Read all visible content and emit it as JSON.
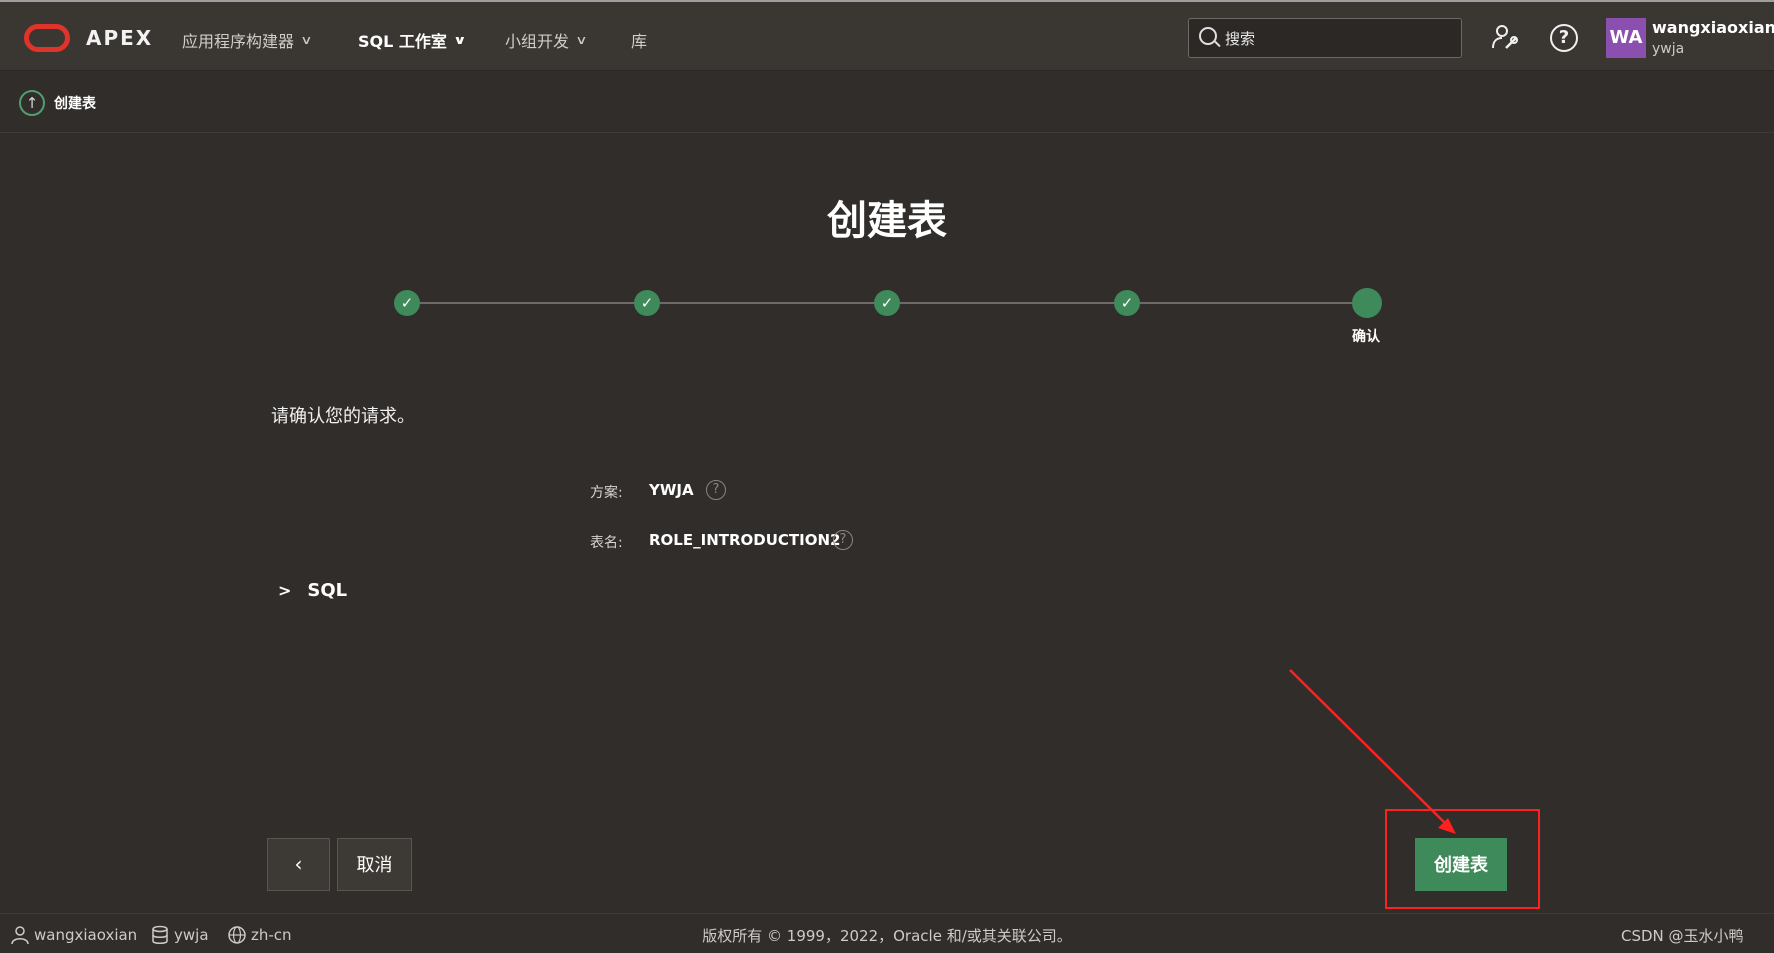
{
  "header": {
    "brand": "APEX",
    "nav": [
      {
        "label": "应用程序构建器"
      },
      {
        "label": "SQL 工作室"
      },
      {
        "label": "小组开发"
      },
      {
        "label": "库"
      }
    ],
    "search_placeholder": "搜索",
    "help_glyph": "?",
    "user": {
      "initials": "WA",
      "name": "wangxiaoxian",
      "workspace": "ywja"
    },
    "avatar_color": "#8b4fb0"
  },
  "breadcrumb": {
    "label": "创建表"
  },
  "main": {
    "title": "创建表",
    "steps_total": 5,
    "steps_completed": 4,
    "current_step_label": "确认",
    "confirm_message": "请确认您的请求。",
    "fields": [
      {
        "label": "方案:",
        "value": "YWJA"
      },
      {
        "label": "表名:",
        "value": "ROLE_INTRODUCTION2"
      }
    ],
    "sql_toggle_label": "SQL",
    "buttons": {
      "back_glyph": "‹",
      "cancel": "取消",
      "create": "创建表"
    },
    "accent_color": "#3e8a5a",
    "annotation_color": "#ff2020"
  },
  "footer": {
    "user": "wangxiaoxian",
    "workspace": "ywja",
    "language": "zh-cn",
    "copyright": "版权所有 © 1999，2022，Oracle 和/或其关联公司。",
    "watermark": "CSDN @玉水小鸭"
  }
}
